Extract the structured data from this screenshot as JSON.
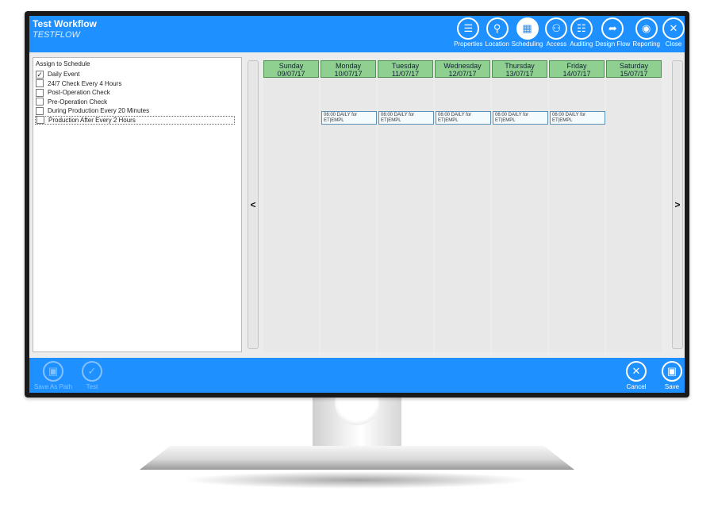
{
  "header": {
    "title": "Test Workflow",
    "subtitle": "TESTFLOW",
    "toolbar": [
      {
        "label": "Properties",
        "icon": "list-icon",
        "glyph": "☰"
      },
      {
        "label": "Location",
        "icon": "location-icon",
        "glyph": "⚲"
      },
      {
        "label": "Scheduling",
        "icon": "calendar-icon",
        "glyph": "▦",
        "active": true
      },
      {
        "label": "Access",
        "icon": "users-icon",
        "glyph": "⚇"
      },
      {
        "label": "Auditing",
        "icon": "clipboard-icon",
        "glyph": "☷"
      },
      {
        "label": "Design Flow",
        "icon": "share-arrow-icon",
        "glyph": "➦"
      },
      {
        "label": "Reporting",
        "icon": "eye-icon",
        "glyph": "◉"
      },
      {
        "label": "Close",
        "icon": "close-icon",
        "glyph": "✕"
      }
    ]
  },
  "left_panel": {
    "heading": "Assign to Schedule",
    "items": [
      {
        "label": "Daily Event",
        "checked": true
      },
      {
        "label": "24/7 Check Every 4 Hours",
        "checked": false
      },
      {
        "label": "Post-Operation Check",
        "checked": false
      },
      {
        "label": "Pre-Operation Check",
        "checked": false
      },
      {
        "label": "During Production Every 20 Minutes",
        "checked": false
      },
      {
        "label": "Production After Every 2 Hours",
        "checked": false
      }
    ]
  },
  "nav": {
    "prev": "<",
    "next": ">"
  },
  "calendar": {
    "days": [
      {
        "name": "Sunday",
        "date": "09/07/17",
        "event": null
      },
      {
        "name": "Monday",
        "date": "10/07/17",
        "event": "06:00 DAILY for ET|EMPL"
      },
      {
        "name": "Tuesday",
        "date": "11/07/17",
        "event": "06:00 DAILY for ET|EMPL"
      },
      {
        "name": "Wednesday",
        "date": "12/07/17",
        "event": "06:00 DAILY for ET|EMPL"
      },
      {
        "name": "Thursday",
        "date": "13/07/17",
        "event": "06:00 DAILY for ET|EMPL"
      },
      {
        "name": "Friday",
        "date": "14/07/17",
        "event": "06:00 DAILY for ET|EMPL"
      },
      {
        "name": "Saturday",
        "date": "15/07/17",
        "event": null
      }
    ]
  },
  "footer": {
    "left": [
      {
        "label": "Save As Path",
        "icon": "save-icon",
        "glyph": "▣"
      },
      {
        "label": "Test",
        "icon": "test-icon",
        "glyph": "✓"
      }
    ],
    "right": [
      {
        "label": "Cancel",
        "icon": "cancel-icon",
        "glyph": "✕"
      },
      {
        "label": "Save",
        "icon": "save-icon",
        "glyph": "▣"
      }
    ]
  },
  "colors": {
    "accent": "#1e90ff",
    "day_header": "#8fcf8f"
  }
}
